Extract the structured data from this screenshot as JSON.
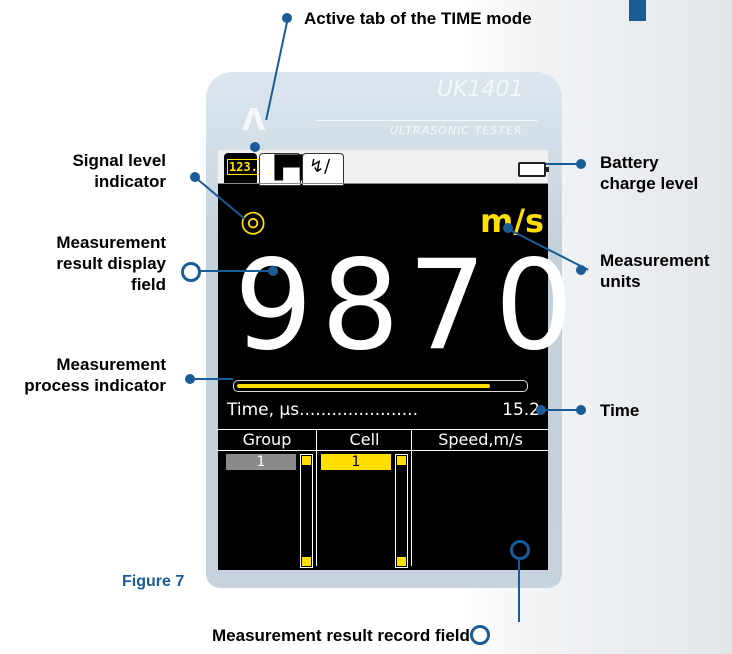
{
  "device": {
    "model": "UK1401",
    "subtitle": "ULTRASONIC TESTER"
  },
  "screen": {
    "tabs": [
      {
        "label": "123.0",
        "active": true
      },
      {
        "glyph": "▐▀▌"
      },
      {
        "glyph": "↯/"
      }
    ],
    "units": "m/s",
    "value": "9870",
    "progress_fraction": 0.88,
    "time_label": "Time, µs......................",
    "time_value": "15.2",
    "table": {
      "headers": [
        "Group",
        "Cell",
        "Speed,m/s"
      ],
      "group_value": "1",
      "cell_value": "1"
    }
  },
  "annotations": {
    "active_tab": "Active tab of the TIME mode",
    "signal_level": [
      "Signal level",
      "indicator"
    ],
    "result_display": [
      "Measurement",
      "result display",
      "field"
    ],
    "process_indicator": [
      "Measurement",
      "process indicator"
    ],
    "battery": [
      "Battery",
      "charge level"
    ],
    "units": [
      "Measurement",
      "units"
    ],
    "time": "Time",
    "record_field": "Measurement result record field"
  },
  "figure_label": "Figure 7",
  "colors": {
    "accent_blue": "#1a5c96",
    "screen_yellow": "#ffde00"
  }
}
